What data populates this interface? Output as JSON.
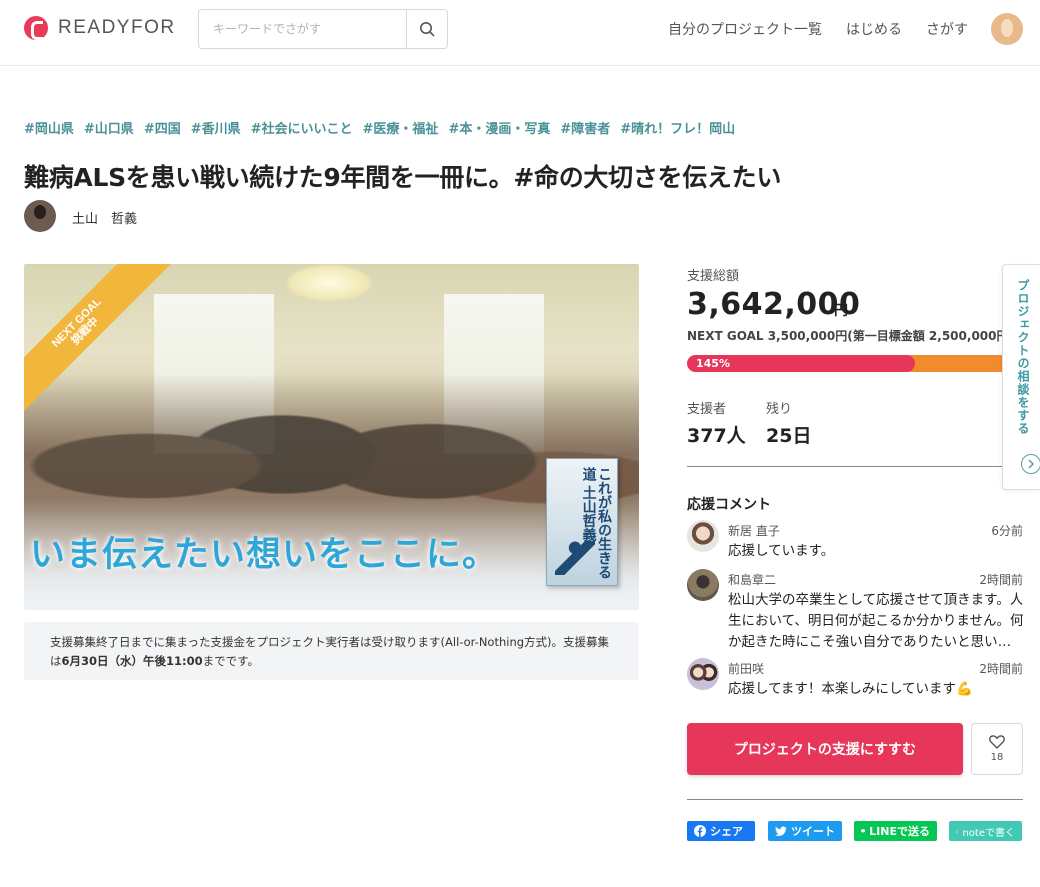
{
  "header": {
    "logo_text": "READYFOR",
    "search_placeholder": "キーワードでさがす",
    "nav": [
      "自分のプロジェクト一覧",
      "はじめる",
      "さがす"
    ]
  },
  "project": {
    "tags": [
      "#岡山県",
      "#山口県",
      "#四国",
      "#香川県",
      "#社会にいいこと",
      "#医療・福祉",
      "#本・漫画・写真",
      "#障害者",
      "#晴れ！フレ！岡山"
    ],
    "title": "難病ALSを患い戦い続けた9年間を一冊に。#命の大切さを伝えたい",
    "owner_name": "土山　哲義",
    "hero_caption": "いま伝えたい想いをここに。",
    "book_title": "これが私の生きる道 土山哲義",
    "badge_line1": "NEXT GOAL",
    "badge_line2": "挑戦中",
    "notice_pre": "支援募集終了日までに集まった支援金をプロジェクト実行者は受け取ります(All-or-Nothing方式)。支援募集は",
    "notice_deadline": "6月30日（水）午後11:00",
    "notice_post": "までです。"
  },
  "funding": {
    "total_label": "支援総額",
    "amount": "3,642,000",
    "unit": "円",
    "next_goal": "NEXT GOAL 3,500,000円(第一目標金額 2,500,000円)",
    "progress_text": "145%",
    "progress_percent": 145,
    "supporters_label": "支援者",
    "supporters": "377人",
    "remaining_label": "残り",
    "remaining": "25日"
  },
  "comments": {
    "title": "応援コメント",
    "items": [
      {
        "name": "新居 直子",
        "time": "6分前",
        "body": "応援しています。"
      },
      {
        "name": "和島章二",
        "time": "2時間前",
        "body": "松山大学の卒業生として応援させて頂きます。人生において、明日何が起こるか分かりません。何か起きた時にこそ強い自分でありたいと思います。"
      },
      {
        "name": "前田咲",
        "time": "2時間前",
        "body": "応援してます！本楽しみにしています💪"
      }
    ]
  },
  "actions": {
    "support_label": "プロジェクトの支援にすすむ",
    "favorite_count": "18",
    "share": {
      "facebook": "シェア",
      "twitter": "ツイート",
      "line": "LINEで送る",
      "note": "noteで書く"
    }
  },
  "side_tab": {
    "label": "プロジェクトの相談をする"
  },
  "colors": {
    "accent": "#e6365a",
    "tag": "#4a9297",
    "progress_over": "#f28b2c",
    "badge": "#f3b63c"
  }
}
